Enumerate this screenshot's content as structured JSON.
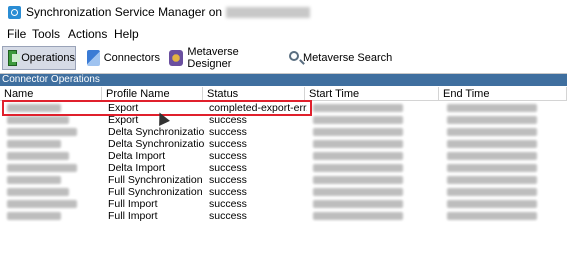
{
  "window": {
    "title": "Synchronization Service Manager on"
  },
  "menu": [
    "File",
    "Tools",
    "Actions",
    "Help"
  ],
  "toolbar": {
    "operations": "Operations",
    "connectors": "Connectors",
    "metaverse_designer": "Metaverse Designer",
    "metaverse_search": "Metaverse Search"
  },
  "section": {
    "title": "Connector Operations"
  },
  "table": {
    "columns": [
      "Name",
      "Profile Name",
      "Status",
      "Start Time",
      "End Time"
    ],
    "rows": [
      {
        "profile": "Export",
        "status": "completed-export-err..."
      },
      {
        "profile": "Export",
        "status": "success"
      },
      {
        "profile": "Delta Synchronization",
        "status": "success"
      },
      {
        "profile": "Delta Synchronization",
        "status": "success"
      },
      {
        "profile": "Delta Import",
        "status": "success"
      },
      {
        "profile": "Delta Import",
        "status": "success"
      },
      {
        "profile": "Full Synchronization",
        "status": "success"
      },
      {
        "profile": "Full Synchronization",
        "status": "success"
      },
      {
        "profile": "Full Import",
        "status": "success"
      },
      {
        "profile": "Full Import",
        "status": "success"
      }
    ]
  },
  "colors": {
    "section_header": "#3f6f9f",
    "highlight": "#e0202c",
    "selected_button": "#d6dbe6"
  }
}
